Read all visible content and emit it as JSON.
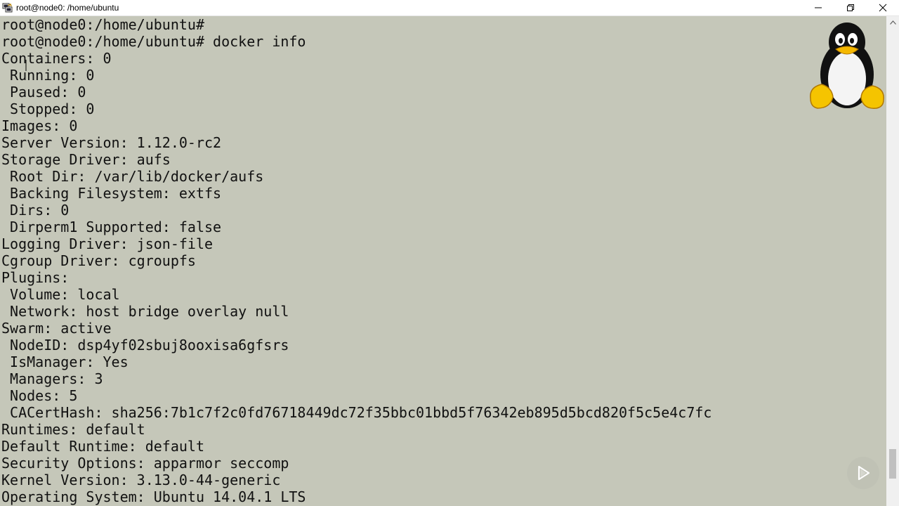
{
  "window": {
    "title": "root@node0: /home/ubuntu",
    "controls": [
      "minimize",
      "restore",
      "close"
    ]
  },
  "terminal": {
    "lines": [
      "root@node0:/home/ubuntu#",
      "root@node0:/home/ubuntu# docker info",
      "Containers: 0",
      " Running: 0",
      " Paused: 0",
      " Stopped: 0",
      "Images: 0",
      "Server Version: 1.12.0-rc2",
      "Storage Driver: aufs",
      " Root Dir: /var/lib/docker/aufs",
      " Backing Filesystem: extfs",
      " Dirs: 0",
      " Dirperm1 Supported: false",
      "Logging Driver: json-file",
      "Cgroup Driver: cgroupfs",
      "Plugins:",
      " Volume: local",
      " Network: host bridge overlay null",
      "Swarm: active",
      " NodeID: dsp4yf02sbuj8ooxisa6gfsrs",
      " IsManager: Yes",
      " Managers: 3",
      " Nodes: 5",
      " CACertHash: sha256:7b1c7f2c0fd76718449dc72f35bbc01bbd5f76342eb895d5bcd820f5c5e4c7fc",
      "Runtimes: default",
      "Default Runtime: default",
      "Security Options: apparmor seccomp",
      "Kernel Version: 3.13.0-44-generic",
      "Operating System: Ubuntu 14.04.1 LTS"
    ]
  },
  "colors": {
    "terminal_bg": "#c5c7b9",
    "terminal_fg": "#111111"
  },
  "icons": {
    "app": "putty-icon",
    "overlay": "tux-penguin",
    "player": "play-icon"
  }
}
